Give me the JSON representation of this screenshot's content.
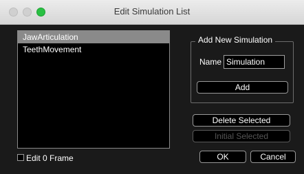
{
  "window": {
    "title": "Edit Simulation List"
  },
  "simulation_list": {
    "items": [
      {
        "label": "JawArticulation",
        "selected": true
      },
      {
        "label": "TeethMovement",
        "selected": false
      }
    ]
  },
  "options": {
    "edit_frame_label": "Edit 0 Frame",
    "edit_frame_checked": false
  },
  "add_group": {
    "title": "Add New Simulation",
    "name_label": "Name",
    "name_value": "Simulation",
    "add_label": "Add"
  },
  "actions": {
    "delete_label": "Delete Selected",
    "initial_label": "Initial Selected",
    "ok_label": "OK",
    "cancel_label": "Cancel"
  },
  "colors": {
    "zoom_green": "#29c043",
    "selection": "#8a8a8a",
    "dialog_bg": "#1a1a1a"
  }
}
